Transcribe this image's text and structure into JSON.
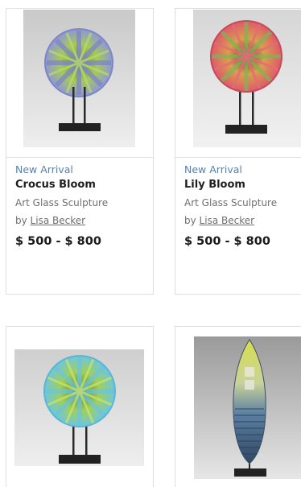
{
  "products": [
    {
      "badge": "New Arrival",
      "name": "Crocus Bloom",
      "category": "Art Glass Sculpture",
      "by_prefix": "by",
      "artist": "Lisa Becker",
      "price": "$ 500 - $ 800"
    },
    {
      "badge": "New Arrival",
      "name": "Lily Bloom",
      "category": "Art Glass Sculpture",
      "by_prefix": "by",
      "artist": "Lisa Becker",
      "price": "$ 500 - $ 800"
    },
    {},
    {}
  ],
  "colors": {
    "badge": "#5b7fa8",
    "title": "#1f1f1f",
    "muted": "#6f6f6f",
    "border": "#dedede"
  }
}
